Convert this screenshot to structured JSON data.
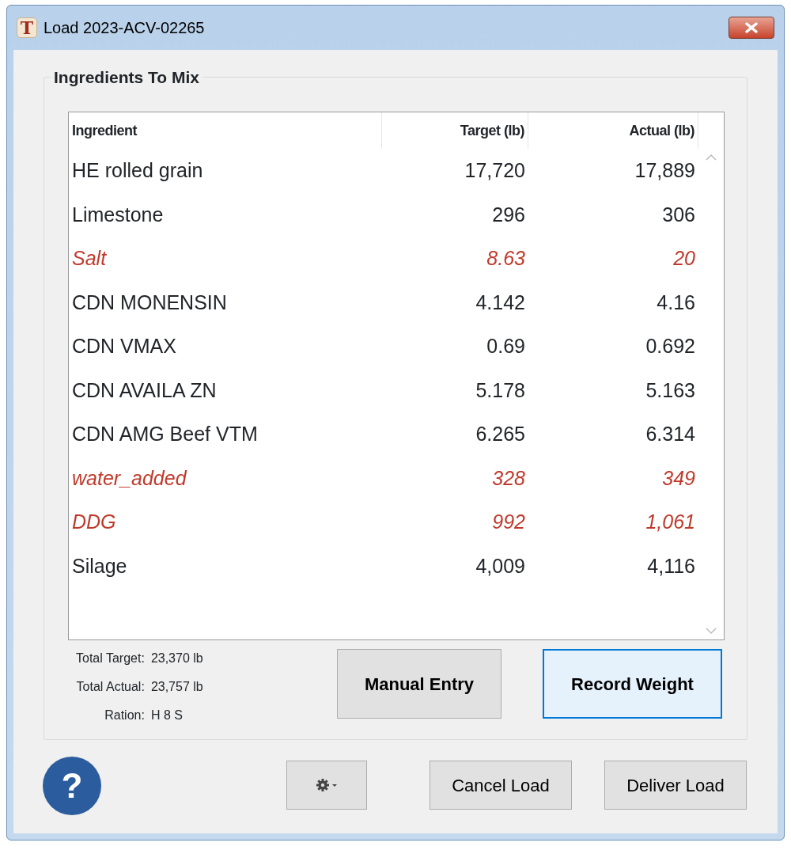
{
  "window": {
    "title": "Load 2023-ACV-02265",
    "app_icon_letter": "T"
  },
  "group": {
    "title": "Ingredients To Mix"
  },
  "table": {
    "columns": [
      "Ingredient",
      "Target (lb)",
      "Actual (lb)"
    ],
    "rows": [
      {
        "ingredient": "HE rolled grain",
        "target": "17,720",
        "actual": "17,889",
        "flagged": false
      },
      {
        "ingredient": "Limestone",
        "target": "296",
        "actual": "306",
        "flagged": false
      },
      {
        "ingredient": "Salt",
        "target": "8.63",
        "actual": "20",
        "flagged": true
      },
      {
        "ingredient": "CDN MONENSIN",
        "target": "4.142",
        "actual": "4.16",
        "flagged": false
      },
      {
        "ingredient": "CDN VMAX",
        "target": "0.69",
        "actual": "0.692",
        "flagged": false
      },
      {
        "ingredient": "CDN AVAILA ZN",
        "target": "5.178",
        "actual": "5.163",
        "flagged": false
      },
      {
        "ingredient": "CDN AMG Beef VTM",
        "target": "6.265",
        "actual": "6.314",
        "flagged": false
      },
      {
        "ingredient": "water_added",
        "target": "328",
        "actual": "349",
        "flagged": true
      },
      {
        "ingredient": "DDG",
        "target": "992",
        "actual": "1,061",
        "flagged": true
      },
      {
        "ingredient": "Silage",
        "target": "4,009",
        "actual": "4,116",
        "flagged": false
      }
    ]
  },
  "summary": [
    {
      "label": "Total Target:",
      "value": "23,370 lb"
    },
    {
      "label": "Total Actual:",
      "value": "23,757 lb"
    },
    {
      "label": "Ration:",
      "value": "H 8 S"
    }
  ],
  "action_buttons": [
    {
      "label": "Manual Entry",
      "focused": false
    },
    {
      "label": "Record Weight",
      "focused": true
    }
  ],
  "help": "?",
  "footer_buttons": [
    "Cancel Load",
    "Deliver Load"
  ]
}
